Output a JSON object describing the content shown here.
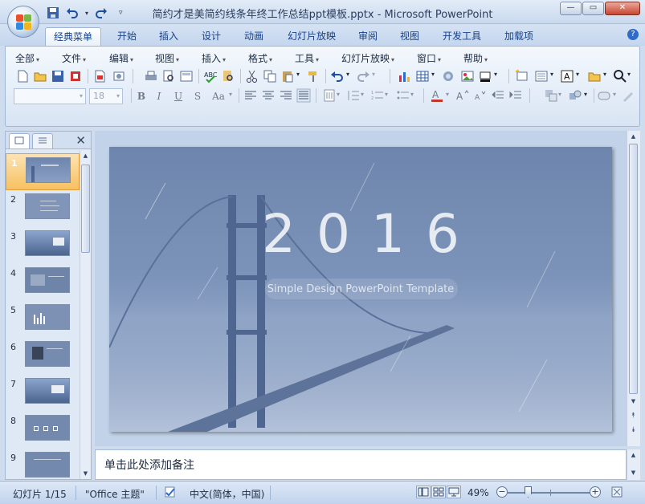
{
  "window": {
    "title": "简约才是美简约线条年终工作总结ppt模板.pptx - Microsoft PowerPoint"
  },
  "ribbon_tabs": [
    "经典菜单",
    "开始",
    "插入",
    "设计",
    "动画",
    "幻灯片放映",
    "审阅",
    "视图",
    "开发工具",
    "加载项"
  ],
  "active_tab": "经典菜单",
  "classic_menu": [
    "全部",
    "文件",
    "编辑",
    "视图",
    "插入",
    "格式",
    "工具",
    "幻灯片放映",
    "窗口",
    "帮助"
  ],
  "format_bar": {
    "font_name": "",
    "font_size": "18",
    "bold": "B",
    "italic": "I",
    "underline": "U",
    "shadow": "S",
    "change_case": "Aa"
  },
  "slides": [
    {
      "num": "1"
    },
    {
      "num": "2"
    },
    {
      "num": "3"
    },
    {
      "num": "4"
    },
    {
      "num": "5"
    },
    {
      "num": "6"
    },
    {
      "num": "7"
    },
    {
      "num": "8"
    },
    {
      "num": "9"
    }
  ],
  "selected_slide": 1,
  "slide": {
    "year": "2016",
    "subtitle": "Simple Design PowerPoint Template",
    "background_color": "#7c93b9"
  },
  "notes": {
    "placeholder": "单击此处添加备注"
  },
  "status": {
    "slide_counter": "幻灯片 1/15",
    "theme": "\"Office 主题\"",
    "language": "中文(简体，中国)",
    "zoom": "49%"
  },
  "colors": {
    "ribbon_accent": "#15428b",
    "selected_slide": "#f7c160"
  }
}
